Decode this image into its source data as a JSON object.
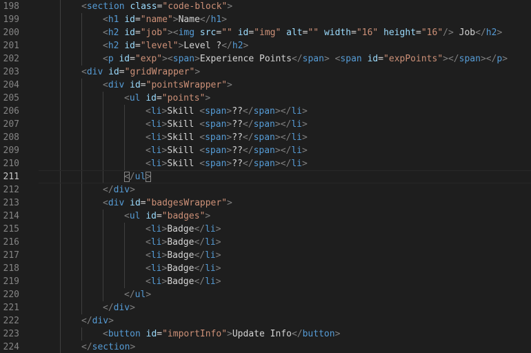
{
  "editor": {
    "current_line": 211,
    "lines": [
      {
        "n": 198,
        "indent": 2,
        "tokens": [
          [
            "p",
            "<"
          ],
          [
            "tag",
            "section"
          ],
          [
            "t",
            " "
          ],
          [
            "attr",
            "class"
          ],
          [
            "eq",
            "="
          ],
          [
            "str",
            "\"code-block\""
          ],
          [
            "p",
            ">"
          ]
        ]
      },
      {
        "n": 199,
        "indent": 3,
        "tokens": [
          [
            "p",
            "<"
          ],
          [
            "tag",
            "h1"
          ],
          [
            "t",
            " "
          ],
          [
            "attr",
            "id"
          ],
          [
            "eq",
            "="
          ],
          [
            "str",
            "\"name\""
          ],
          [
            "p",
            ">"
          ],
          [
            "t",
            "Name"
          ],
          [
            "p",
            "</"
          ],
          [
            "tag",
            "h1"
          ],
          [
            "p",
            ">"
          ]
        ]
      },
      {
        "n": 200,
        "indent": 3,
        "tokens": [
          [
            "p",
            "<"
          ],
          [
            "tag",
            "h2"
          ],
          [
            "t",
            " "
          ],
          [
            "attr",
            "id"
          ],
          [
            "eq",
            "="
          ],
          [
            "str",
            "\"job\""
          ],
          [
            "p",
            "><"
          ],
          [
            "tag",
            "img"
          ],
          [
            "t",
            " "
          ],
          [
            "attr",
            "src"
          ],
          [
            "eq",
            "="
          ],
          [
            "str",
            "\"\""
          ],
          [
            "t",
            " "
          ],
          [
            "attr",
            "id"
          ],
          [
            "eq",
            "="
          ],
          [
            "str",
            "\"img\""
          ],
          [
            "t",
            " "
          ],
          [
            "attr",
            "alt"
          ],
          [
            "eq",
            "="
          ],
          [
            "str",
            "\"\""
          ],
          [
            "t",
            " "
          ],
          [
            "attr",
            "width"
          ],
          [
            "eq",
            "="
          ],
          [
            "str",
            "\"16\""
          ],
          [
            "t",
            " "
          ],
          [
            "attr",
            "height"
          ],
          [
            "eq",
            "="
          ],
          [
            "str",
            "\"16\""
          ],
          [
            "p",
            "/>"
          ],
          [
            "t",
            " Job"
          ],
          [
            "p",
            "</"
          ],
          [
            "tag",
            "h2"
          ],
          [
            "p",
            ">"
          ]
        ]
      },
      {
        "n": 201,
        "indent": 3,
        "tokens": [
          [
            "p",
            "<"
          ],
          [
            "tag",
            "h2"
          ],
          [
            "t",
            " "
          ],
          [
            "attr",
            "id"
          ],
          [
            "eq",
            "="
          ],
          [
            "str",
            "\"level\""
          ],
          [
            "p",
            ">"
          ],
          [
            "t",
            "Level ?"
          ],
          [
            "p",
            "</"
          ],
          [
            "tag",
            "h2"
          ],
          [
            "p",
            ">"
          ]
        ]
      },
      {
        "n": 202,
        "indent": 3,
        "tokens": [
          [
            "p",
            "<"
          ],
          [
            "tag",
            "p"
          ],
          [
            "t",
            " "
          ],
          [
            "attr",
            "id"
          ],
          [
            "eq",
            "="
          ],
          [
            "str",
            "\"exp\""
          ],
          [
            "p",
            "><"
          ],
          [
            "tag",
            "span"
          ],
          [
            "p",
            ">"
          ],
          [
            "t",
            "Experience Points"
          ],
          [
            "p",
            "</"
          ],
          [
            "tag",
            "span"
          ],
          [
            "p",
            ">"
          ],
          [
            "t",
            " "
          ],
          [
            "p",
            "<"
          ],
          [
            "tag",
            "span"
          ],
          [
            "t",
            " "
          ],
          [
            "attr",
            "id"
          ],
          [
            "eq",
            "="
          ],
          [
            "str",
            "\"expPoints\""
          ],
          [
            "p",
            "></"
          ],
          [
            "tag",
            "span"
          ],
          [
            "p",
            "></"
          ],
          [
            "tag",
            "p"
          ],
          [
            "p",
            ">"
          ]
        ]
      },
      {
        "n": 203,
        "indent": 2,
        "tokens": [
          [
            "p",
            "<"
          ],
          [
            "tag",
            "div"
          ],
          [
            "t",
            " "
          ],
          [
            "attr",
            "id"
          ],
          [
            "eq",
            "="
          ],
          [
            "str",
            "\"gridWrapper\""
          ],
          [
            "p",
            ">"
          ]
        ]
      },
      {
        "n": 204,
        "indent": 3,
        "tokens": [
          [
            "p",
            "<"
          ],
          [
            "tag",
            "div"
          ],
          [
            "t",
            " "
          ],
          [
            "attr",
            "id"
          ],
          [
            "eq",
            "="
          ],
          [
            "str",
            "\"pointsWrapper\""
          ],
          [
            "p",
            ">"
          ]
        ]
      },
      {
        "n": 205,
        "indent": 4,
        "tokens": [
          [
            "p",
            "<"
          ],
          [
            "tag",
            "ul"
          ],
          [
            "t",
            " "
          ],
          [
            "attr",
            "id"
          ],
          [
            "eq",
            "="
          ],
          [
            "str",
            "\"points\""
          ],
          [
            "p",
            ">"
          ]
        ]
      },
      {
        "n": 206,
        "indent": 5,
        "tokens": [
          [
            "p",
            "<"
          ],
          [
            "tag",
            "li"
          ],
          [
            "p",
            ">"
          ],
          [
            "t",
            "Skill "
          ],
          [
            "p",
            "<"
          ],
          [
            "tag",
            "span"
          ],
          [
            "p",
            ">"
          ],
          [
            "t",
            "??"
          ],
          [
            "p",
            "</"
          ],
          [
            "tag",
            "span"
          ],
          [
            "p",
            "></"
          ],
          [
            "tag",
            "li"
          ],
          [
            "p",
            ">"
          ]
        ]
      },
      {
        "n": 207,
        "indent": 5,
        "tokens": [
          [
            "p",
            "<"
          ],
          [
            "tag",
            "li"
          ],
          [
            "p",
            ">"
          ],
          [
            "t",
            "Skill "
          ],
          [
            "p",
            "<"
          ],
          [
            "tag",
            "span"
          ],
          [
            "p",
            ">"
          ],
          [
            "t",
            "??"
          ],
          [
            "p",
            "</"
          ],
          [
            "tag",
            "span"
          ],
          [
            "p",
            "></"
          ],
          [
            "tag",
            "li"
          ],
          [
            "p",
            ">"
          ]
        ]
      },
      {
        "n": 208,
        "indent": 5,
        "tokens": [
          [
            "p",
            "<"
          ],
          [
            "tag",
            "li"
          ],
          [
            "p",
            ">"
          ],
          [
            "t",
            "Skill "
          ],
          [
            "p",
            "<"
          ],
          [
            "tag",
            "span"
          ],
          [
            "p",
            ">"
          ],
          [
            "t",
            "??"
          ],
          [
            "p",
            "</"
          ],
          [
            "tag",
            "span"
          ],
          [
            "p",
            "></"
          ],
          [
            "tag",
            "li"
          ],
          [
            "p",
            ">"
          ]
        ]
      },
      {
        "n": 209,
        "indent": 5,
        "tokens": [
          [
            "p",
            "<"
          ],
          [
            "tag",
            "li"
          ],
          [
            "p",
            ">"
          ],
          [
            "t",
            "Skill "
          ],
          [
            "p",
            "<"
          ],
          [
            "tag",
            "span"
          ],
          [
            "p",
            ">"
          ],
          [
            "t",
            "??"
          ],
          [
            "p",
            "</"
          ],
          [
            "tag",
            "span"
          ],
          [
            "p",
            "></"
          ],
          [
            "tag",
            "li"
          ],
          [
            "p",
            ">"
          ]
        ]
      },
      {
        "n": 210,
        "indent": 5,
        "tokens": [
          [
            "p",
            "<"
          ],
          [
            "tag",
            "li"
          ],
          [
            "p",
            ">"
          ],
          [
            "t",
            "Skill "
          ],
          [
            "p",
            "<"
          ],
          [
            "tag",
            "span"
          ],
          [
            "p",
            ">"
          ],
          [
            "t",
            "??"
          ],
          [
            "p",
            "</"
          ],
          [
            "tag",
            "span"
          ],
          [
            "p",
            "></"
          ],
          [
            "tag",
            "li"
          ],
          [
            "p",
            ">"
          ]
        ]
      },
      {
        "n": 211,
        "indent": 4,
        "tokens": [
          [
            "pm",
            "<"
          ],
          [
            "p",
            "/"
          ],
          [
            "tag",
            "ul"
          ],
          [
            "pm",
            ">"
          ]
        ]
      },
      {
        "n": 212,
        "indent": 3,
        "tokens": [
          [
            "p",
            "</"
          ],
          [
            "tag",
            "div"
          ],
          [
            "p",
            ">"
          ]
        ]
      },
      {
        "n": 213,
        "indent": 3,
        "tokens": [
          [
            "p",
            "<"
          ],
          [
            "tag",
            "div"
          ],
          [
            "t",
            " "
          ],
          [
            "attr",
            "id"
          ],
          [
            "eq",
            "="
          ],
          [
            "str",
            "\"badgesWrapper\""
          ],
          [
            "p",
            ">"
          ]
        ]
      },
      {
        "n": 214,
        "indent": 4,
        "tokens": [
          [
            "p",
            "<"
          ],
          [
            "tag",
            "ul"
          ],
          [
            "t",
            " "
          ],
          [
            "attr",
            "id"
          ],
          [
            "eq",
            "="
          ],
          [
            "str",
            "\"badges\""
          ],
          [
            "p",
            ">"
          ]
        ]
      },
      {
        "n": 215,
        "indent": 5,
        "tokens": [
          [
            "p",
            "<"
          ],
          [
            "tag",
            "li"
          ],
          [
            "p",
            ">"
          ],
          [
            "t",
            "Badge"
          ],
          [
            "p",
            "</"
          ],
          [
            "tag",
            "li"
          ],
          [
            "p",
            ">"
          ]
        ]
      },
      {
        "n": 216,
        "indent": 5,
        "tokens": [
          [
            "p",
            "<"
          ],
          [
            "tag",
            "li"
          ],
          [
            "p",
            ">"
          ],
          [
            "t",
            "Badge"
          ],
          [
            "p",
            "</"
          ],
          [
            "tag",
            "li"
          ],
          [
            "p",
            ">"
          ]
        ]
      },
      {
        "n": 217,
        "indent": 5,
        "tokens": [
          [
            "p",
            "<"
          ],
          [
            "tag",
            "li"
          ],
          [
            "p",
            ">"
          ],
          [
            "t",
            "Badge"
          ],
          [
            "p",
            "</"
          ],
          [
            "tag",
            "li"
          ],
          [
            "p",
            ">"
          ]
        ]
      },
      {
        "n": 218,
        "indent": 5,
        "tokens": [
          [
            "p",
            "<"
          ],
          [
            "tag",
            "li"
          ],
          [
            "p",
            ">"
          ],
          [
            "t",
            "Badge"
          ],
          [
            "p",
            "</"
          ],
          [
            "tag",
            "li"
          ],
          [
            "p",
            ">"
          ]
        ]
      },
      {
        "n": 219,
        "indent": 5,
        "tokens": [
          [
            "p",
            "<"
          ],
          [
            "tag",
            "li"
          ],
          [
            "p",
            ">"
          ],
          [
            "t",
            "Badge"
          ],
          [
            "p",
            "</"
          ],
          [
            "tag",
            "li"
          ],
          [
            "p",
            ">"
          ]
        ]
      },
      {
        "n": 220,
        "indent": 4,
        "tokens": [
          [
            "p",
            "</"
          ],
          [
            "tag",
            "ul"
          ],
          [
            "p",
            ">"
          ]
        ]
      },
      {
        "n": 221,
        "indent": 3,
        "tokens": [
          [
            "p",
            "</"
          ],
          [
            "tag",
            "div"
          ],
          [
            "p",
            ">"
          ]
        ]
      },
      {
        "n": 222,
        "indent": 2,
        "tokens": [
          [
            "p",
            "</"
          ],
          [
            "tag",
            "div"
          ],
          [
            "p",
            ">"
          ]
        ]
      },
      {
        "n": 223,
        "indent": 3,
        "tokens": [
          [
            "p",
            "<"
          ],
          [
            "tag",
            "button"
          ],
          [
            "t",
            " "
          ],
          [
            "attr",
            "id"
          ],
          [
            "eq",
            "="
          ],
          [
            "str",
            "\"importInfo\""
          ],
          [
            "p",
            ">"
          ],
          [
            "t",
            "Update Info"
          ],
          [
            "p",
            "</"
          ],
          [
            "tag",
            "button"
          ],
          [
            "p",
            ">"
          ]
        ]
      },
      {
        "n": 224,
        "indent": 2,
        "tokens": [
          [
            "p",
            "</"
          ],
          [
            "tag",
            "section"
          ],
          [
            "p",
            ">"
          ]
        ]
      }
    ]
  },
  "colors": {
    "background": "#1e1e1e",
    "tag": "#569cd6",
    "attribute": "#9cdcfe",
    "string": "#ce9178",
    "punctuation": "#808080",
    "text": "#d4d4d4",
    "line_number": "#858585"
  }
}
